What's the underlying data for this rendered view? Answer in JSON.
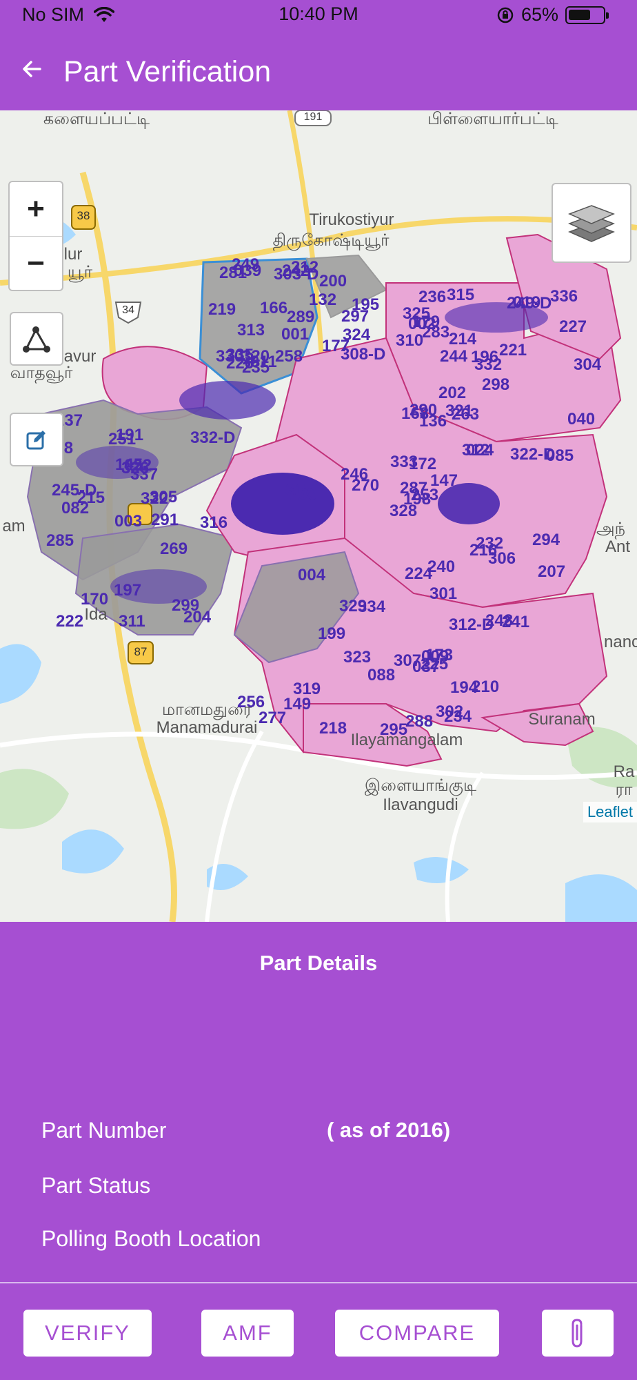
{
  "status_bar": {
    "carrier": "No SIM",
    "time": "10:40 PM",
    "battery": "65%",
    "battery_level": 0.65
  },
  "app_bar": {
    "title": "Part Verification"
  },
  "map": {
    "place_labels": [
      "Tirukostiyur",
      "திருகோஷ்டியூர்",
      "மானமதுரை",
      "Manamadurai",
      "இளையாங்குடி",
      "Ilavangudi",
      "Ilayamangalam",
      "Suranam",
      "Ida",
      "வாதவூர்",
      "avur",
      "lur",
      "யூர்",
      "களையப்பட்டி",
      "பிள்ளையார்பட்டி",
      "அந்",
      "Ant",
      "am",
      "Ra",
      "ரா",
      "nanc"
    ],
    "road_shields": [
      "191",
      "38",
      "34",
      "87"
    ],
    "part_numbers": [
      "001",
      "002",
      "003",
      "004",
      "009",
      "011",
      "019",
      "022",
      "024",
      "037",
      "039",
      "040",
      "082",
      "085",
      "088",
      "132",
      "136",
      "145",
      "147",
      "149",
      "166",
      "168",
      "170",
      "172",
      "173",
      "177",
      "179",
      "191",
      "193",
      "194",
      "195",
      "196",
      "197",
      "198",
      "199",
      "200",
      "202",
      "204",
      "207",
      "210",
      "212",
      "214",
      "215",
      "216",
      "218",
      "219",
      "221",
      "222",
      "224",
      "225",
      "226",
      "227",
      "228",
      "232",
      "234",
      "235",
      "236",
      "237",
      "240",
      "241",
      "242",
      "244",
      "245-D",
      "246",
      "248",
      "249",
      "249-D",
      "251",
      "253",
      "256",
      "258",
      "263",
      "269",
      "270",
      "277",
      "281",
      "283",
      "285",
      "287",
      "288",
      "289",
      "290",
      "291",
      "294",
      "295",
      "297",
      "298",
      "299",
      "301",
      "302",
      "303-D",
      "304",
      "305",
      "306",
      "307",
      "308-D",
      "310",
      "311",
      "312",
      "312-D",
      "313",
      "315",
      "316",
      "317",
      "319",
      "320",
      "321",
      "322",
      "322-D",
      "323",
      "324",
      "325",
      "326",
      "328",
      "329",
      "330",
      "332",
      "332-D",
      "333",
      "334",
      "335",
      "336",
      "337"
    ],
    "attribution": "Leaflet"
  },
  "controls": {
    "zoom_in": "+",
    "zoom_out": "−",
    "icons": [
      "draw-polyline-icon",
      "edit-icon",
      "layers-icon",
      "paperclip-icon",
      "back-arrow-icon"
    ]
  },
  "details": {
    "heading": "Part Details",
    "part_number_label": "Part Number",
    "part_number_value": "( as of 2016)",
    "part_status_label": "Part Status",
    "polling_booth_label": "Polling Booth Location"
  },
  "actions": {
    "verify": "VERIFY",
    "amf": "AMF",
    "compare": "COMPARE"
  },
  "colors": {
    "accent": "#a64fd2",
    "region_pink": "#e9a6d6",
    "region_pink_border": "#c2327a",
    "region_gray": "#9a9a9a",
    "region_blue_border": "#3a8fd6",
    "label_purple": "#4b2ab0"
  }
}
